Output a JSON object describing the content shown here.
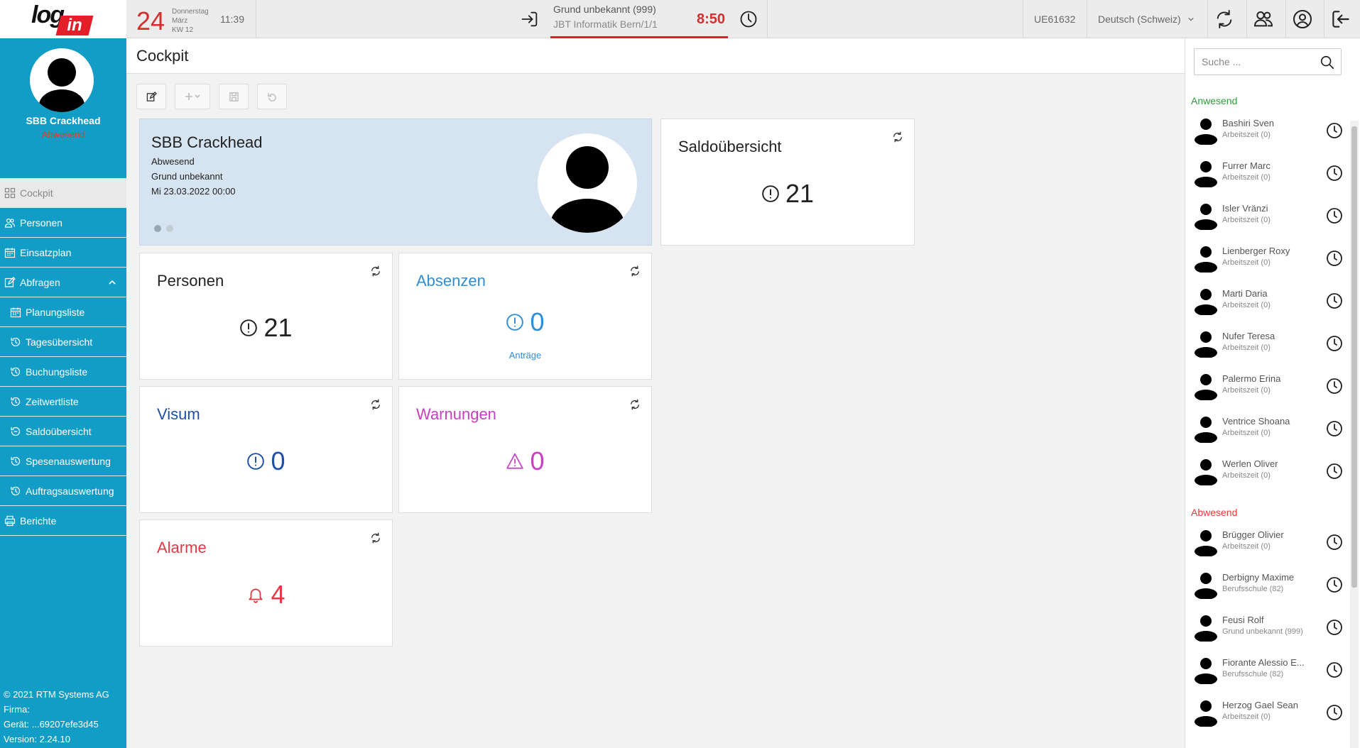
{
  "topbar": {
    "logo_log": "log",
    "logo_in": "in",
    "day": "24",
    "weekday": "Donnerstag",
    "month": "März",
    "week": "KW 12",
    "time": "11:39",
    "booking_reason": "Grund unbekannt (999)",
    "booking_location": "JBT Informatik Bern/1/1",
    "booking_time": "8:50",
    "user_id": "UE61632",
    "language": "Deutsch (Schweiz)"
  },
  "profile": {
    "name": "SBB Crackhead",
    "status": "Abwesend"
  },
  "nav": {
    "cockpit": "Cockpit",
    "personen": "Personen",
    "einsatzplan": "Einsatzplan",
    "abfragen": "Abfragen",
    "planungsliste": "Planungsliste",
    "tagesuebersicht": "Tagesübersicht",
    "buchungsliste": "Buchungsliste",
    "zeitwertliste": "Zeitwertliste",
    "saldouebersicht": "Saldoübersicht",
    "spesenauswertung": "Spesenauswertung",
    "auftragsauswertung": "Auftragsauswertung",
    "berichte": "Berichte"
  },
  "footer": {
    "copyright": "© 2021 RTM Systems AG",
    "firma": "Firma:",
    "geraet": "Gerät: ...69207efe3d45",
    "version": "Version: 2.24.10"
  },
  "main": {
    "title": "Cockpit",
    "person_card": {
      "name": "SBB Crackhead",
      "status": "Abwesend",
      "reason": "Grund unbekannt",
      "date": "Mi 23.03.2022 00:00"
    },
    "saldo": {
      "title": "Saldoübersicht",
      "value": "21"
    },
    "personen": {
      "title": "Personen",
      "value": "21"
    },
    "absenzen": {
      "title": "Absenzen",
      "value": "0",
      "link": "Anträge"
    },
    "visum": {
      "title": "Visum",
      "value": "0"
    },
    "warnungen": {
      "title": "Warnungen",
      "value": "0"
    },
    "alarme": {
      "title": "Alarme",
      "value": "4"
    }
  },
  "colors": {
    "sidebar": "#119dc6",
    "accent_red": "#e3202a",
    "absenzen": "#2e8fd8",
    "visum": "#1f4fa8",
    "warnungen": "#c93fc0",
    "alarme": "#e53946",
    "anwesend": "#2e9d3a"
  },
  "rpanel": {
    "search_placeholder": "Suche ...",
    "group_present": "Anwesend",
    "group_absent": "Abwesend",
    "present": [
      {
        "name": "Bashiri Sven",
        "status": "Arbeitszeit (0)"
      },
      {
        "name": "Furrer Marc",
        "status": "Arbeitszeit (0)"
      },
      {
        "name": "Isler Vränzi",
        "status": "Arbeitszeit (0)"
      },
      {
        "name": "Lienberger Roxy",
        "status": "Arbeitszeit (0)"
      },
      {
        "name": "Marti Daria",
        "status": "Arbeitszeit (0)"
      },
      {
        "name": "Nufer Teresa",
        "status": "Arbeitszeit (0)"
      },
      {
        "name": "Palermo Erina",
        "status": "Arbeitszeit (0)"
      },
      {
        "name": "Ventrice Shoana",
        "status": "Arbeitszeit (0)"
      },
      {
        "name": "Werlen Oliver",
        "status": "Arbeitszeit (0)"
      }
    ],
    "absent": [
      {
        "name": "Brügger Olivier",
        "status": "Arbeitszeit (0)"
      },
      {
        "name": "Derbigny Maxime",
        "status": "Berufsschule (82)"
      },
      {
        "name": "Feusi Rolf",
        "status": "Grund unbekannt (999)"
      },
      {
        "name": "Fiorante Alessio E...",
        "status": "Berufsschule (82)"
      },
      {
        "name": "Herzog Gael Sean",
        "status": "Arbeitszeit (0)"
      }
    ]
  }
}
